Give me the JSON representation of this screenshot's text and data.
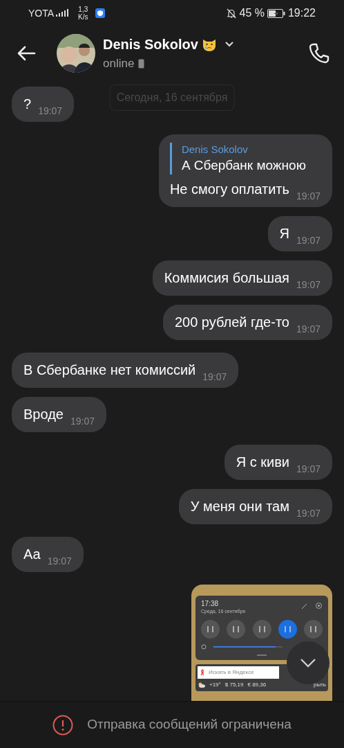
{
  "status_bar": {
    "carrier": "YOTA",
    "speed": "1,3",
    "speed_unit": "K/s",
    "battery": "45 %",
    "time": "19:22"
  },
  "header": {
    "name": "Denis Sokolov",
    "status": "online"
  },
  "date_badge": "Сегодня, 16 сентября",
  "messages": [
    {
      "kind": "text",
      "outgoing": false,
      "text": "?",
      "time": "19:07"
    },
    {
      "kind": "reply",
      "outgoing": true,
      "reply_name": "Denis Sokolov",
      "reply_text": "А Сбербанк можною",
      "text": "Не смогу оплатить",
      "time": "19:07"
    },
    {
      "kind": "text",
      "outgoing": true,
      "text": "Я",
      "time": "19:07"
    },
    {
      "kind": "text",
      "outgoing": true,
      "text": "Коммисия большая",
      "time": "19:07"
    },
    {
      "kind": "text",
      "outgoing": true,
      "text": "200 рублей где-то",
      "time": "19:07"
    },
    {
      "kind": "text",
      "outgoing": false,
      "text": "В Сбербанке нет комиссий",
      "time": "19:07"
    },
    {
      "kind": "text",
      "outgoing": false,
      "text": "Вроде",
      "time": "19:07"
    },
    {
      "kind": "text",
      "outgoing": true,
      "text": "Я с киви",
      "time": "19:07"
    },
    {
      "kind": "text",
      "outgoing": true,
      "text": "У меня они там",
      "time": "19:07"
    },
    {
      "kind": "text",
      "outgoing": false,
      "text": "Аа",
      "time": "19:07"
    },
    {
      "kind": "image",
      "outgoing": true,
      "shot": {
        "brightness": {
          "level": 0.9
        },
        "time": "17:38",
        "date": "Среда, 16 сентября",
        "search": "Искать в Яндексе",
        "weather": "+19°",
        "usd": "$ 75,19",
        "eur": "€ 89,36",
        "open": "рыть"
      }
    }
  ],
  "restriction": "Отправка сообщений ограничена"
}
